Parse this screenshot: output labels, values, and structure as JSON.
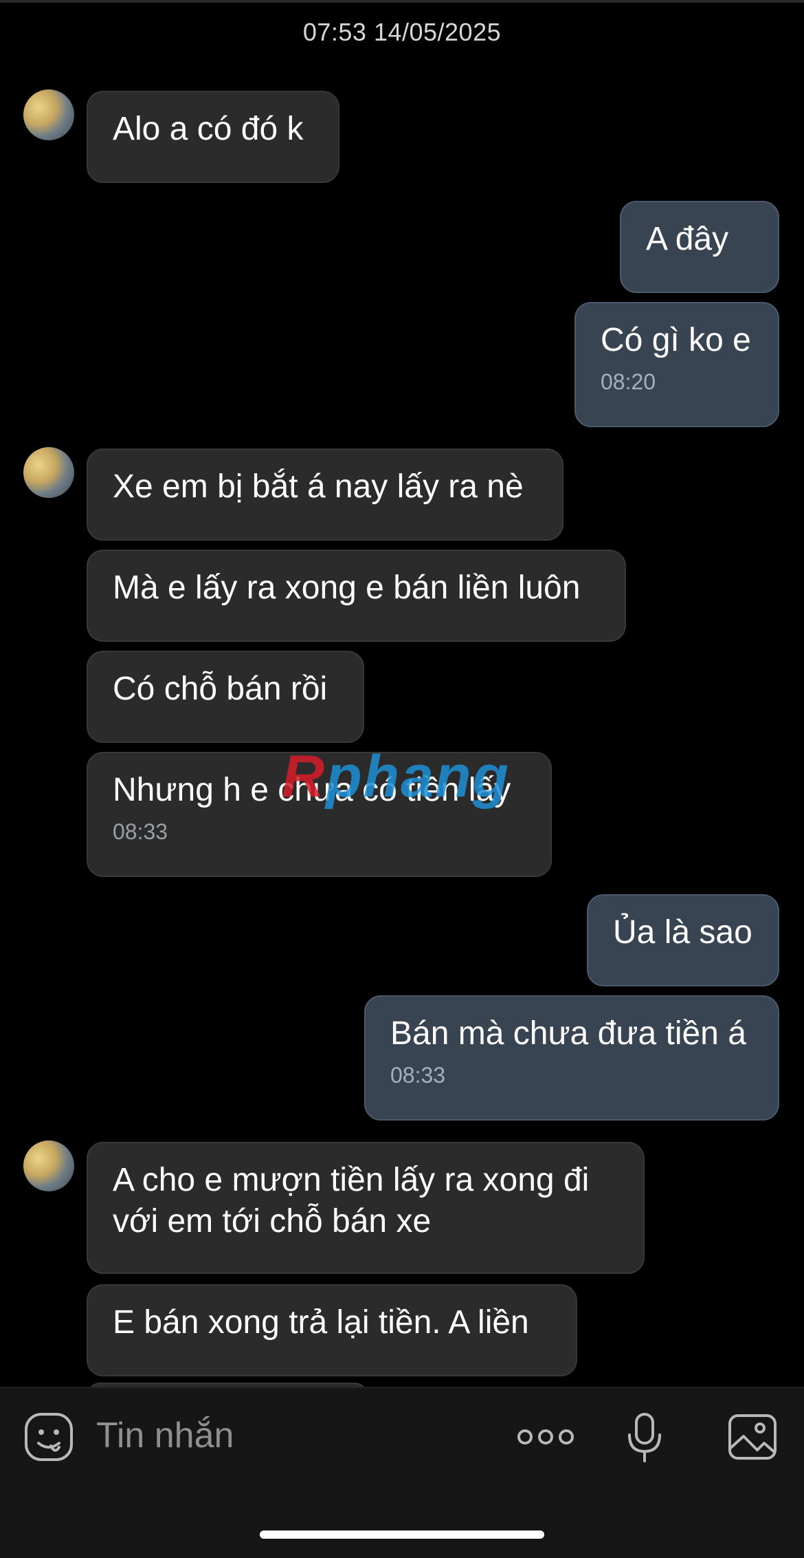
{
  "header": {
    "timestamp": "07:53 14/05/2025"
  },
  "messages": [
    {
      "text": "Alo a có đó k"
    },
    {
      "text": "A đây"
    },
    {
      "text": "Có gì ko e",
      "time": "08:20"
    },
    {
      "text": "Xe em bị bắt á nay lấy ra nè"
    },
    {
      "text": "Mà e lấy ra xong e bán liền luôn"
    },
    {
      "text": "Có chỗ bán rồi"
    },
    {
      "text": "Nhưng h e chưa có tiền lấy",
      "time": "08:33"
    },
    {
      "text": "Ủa là sao"
    },
    {
      "text": "Bán mà chưa đưa tiền á",
      "time": "08:33"
    },
    {
      "text_line1": "A cho e mượn tiền lấy ra xong đi",
      "text_line2": "với em tới chỗ bán xe"
    },
    {
      "text": "E bán xong trả lại tiền. A liền"
    }
  ],
  "watermark": {
    "first": "R",
    "rest": "phang"
  },
  "composer": {
    "placeholder": "Tin nhắn",
    "icons": [
      "emoji-icon",
      "more-icon",
      "microphone-icon",
      "image-icon"
    ]
  },
  "colors": {
    "background": "#000000",
    "incoming_bubble": "#2b2b2b",
    "outgoing_bubble": "#394452",
    "text": "#ffffff",
    "meta_text": "#9aa0a6"
  }
}
